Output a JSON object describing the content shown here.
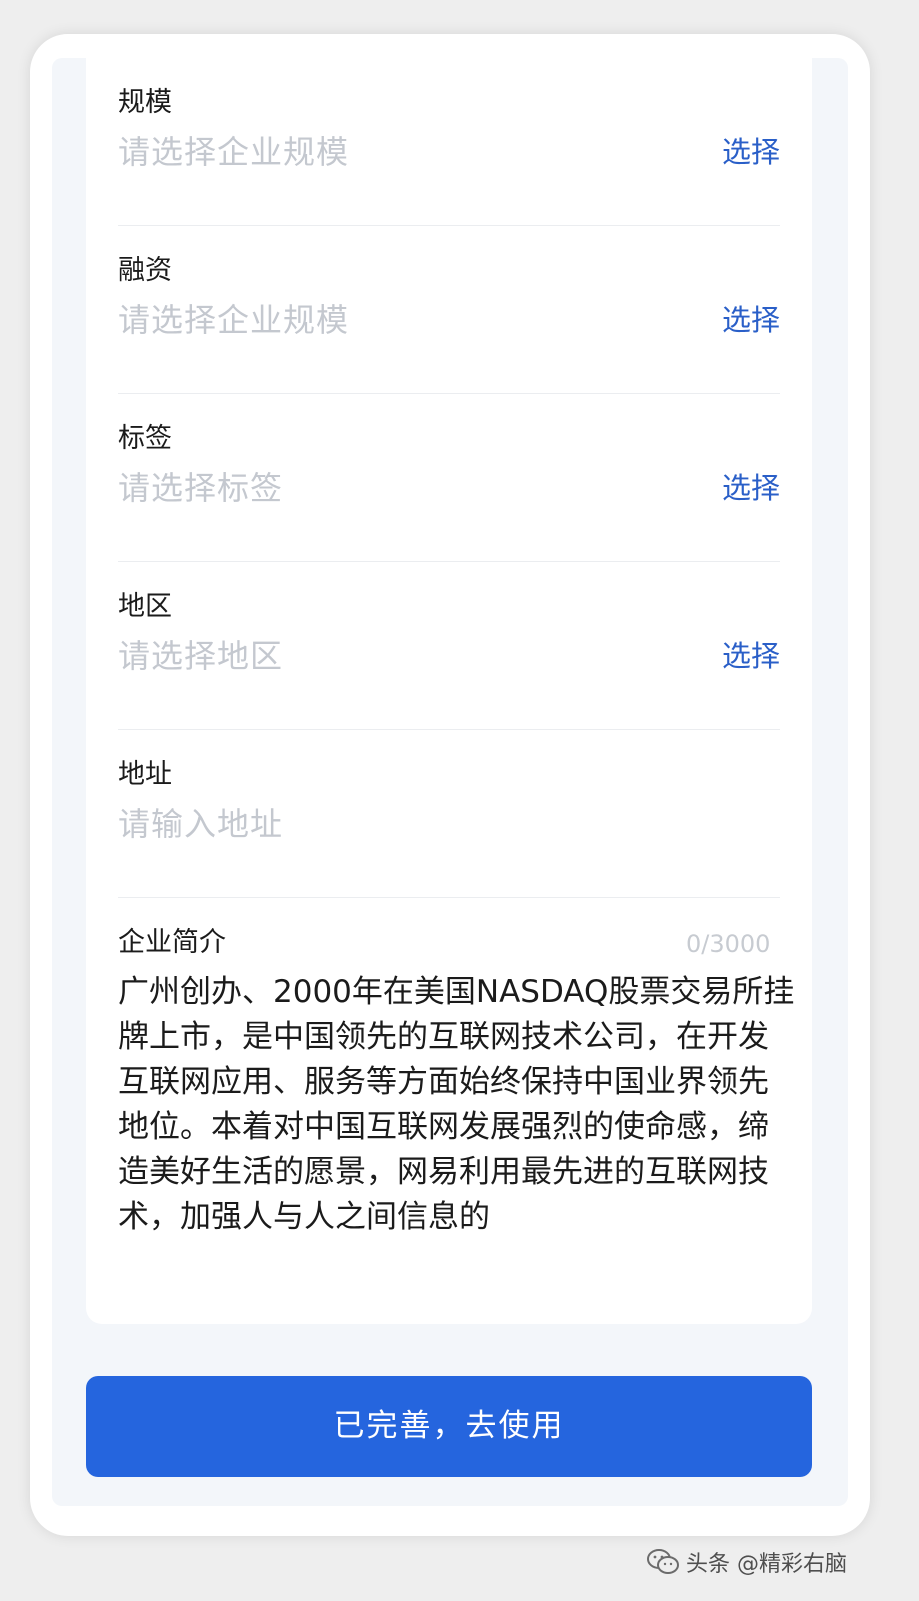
{
  "form": {
    "fields": [
      {
        "label": "规模",
        "placeholder": "请选择企业规模",
        "action": "选择"
      },
      {
        "label": "融资",
        "placeholder": "请选择企业规模",
        "action": "选择"
      },
      {
        "label": "标签",
        "placeholder": "请选择标签",
        "action": "选择"
      },
      {
        "label": "地区",
        "placeholder": "请选择地区",
        "action": "选择"
      },
      {
        "label": "地址",
        "placeholder": "请输入地址"
      }
    ],
    "intro": {
      "label": "企业简介",
      "counter": "0/3000",
      "text": "广州创办、2000年在美国NASDAQ股票交易所挂牌上市，是中国领先的互联网技术公司，在开发互联网应用、服务等方面始终保持中国业界领先地位。本着对中国互联网发展强烈的使命感，缔造美好生活的愿景，网易利用最先进的互联网技术，加强人与人之间信息的"
    }
  },
  "submit": {
    "label": "已完善，去使用"
  },
  "watermark": {
    "text": "头条 @精彩右脑",
    "icon": "wechat-icon"
  }
}
